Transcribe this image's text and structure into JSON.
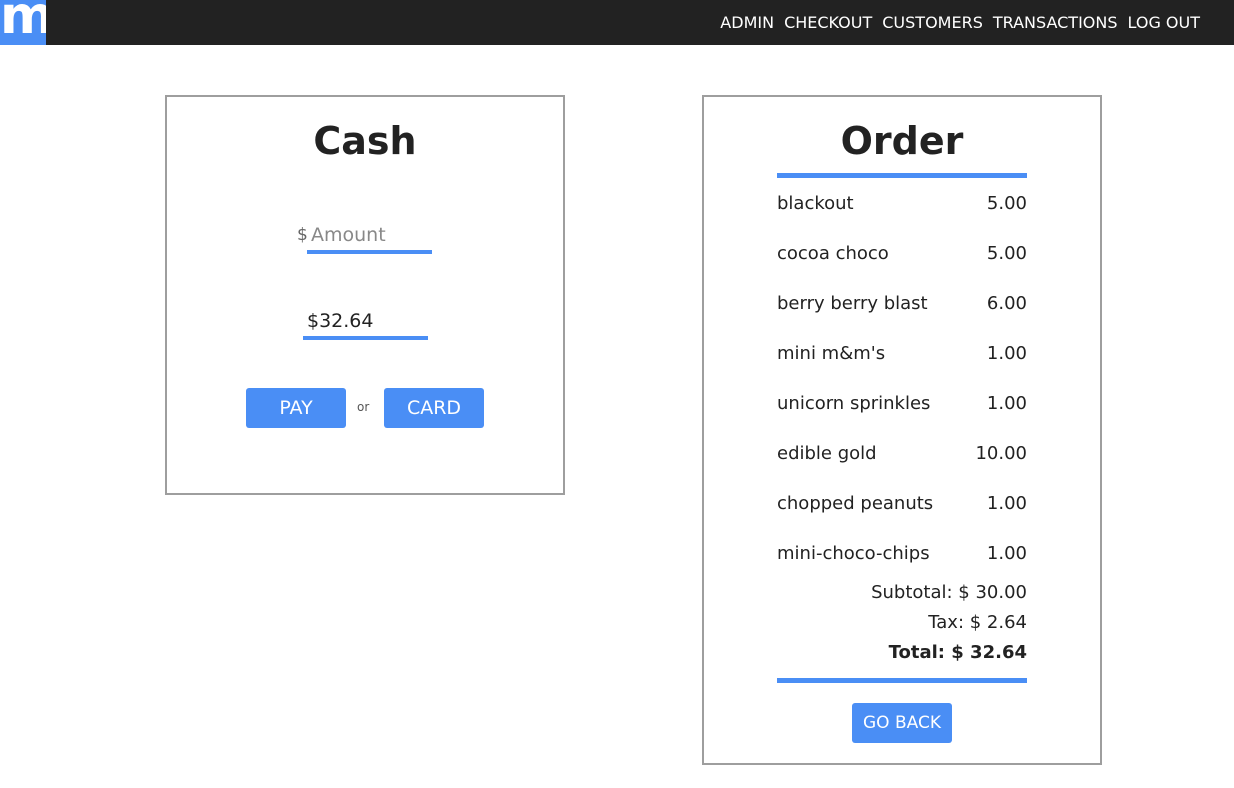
{
  "app": {
    "logo_letter": "m",
    "brand_color": "#4a8ef5"
  },
  "nav": {
    "items": [
      "ADMIN",
      "CHECKOUT",
      "CUSTOMERS",
      "TRANSACTIONS",
      "LOG OUT"
    ]
  },
  "cash": {
    "title": "Cash",
    "currency_symbol": "$",
    "amount_placeholder": "Amount",
    "total_value": "$32.64",
    "pay_label": "PAY",
    "or_label": "or",
    "card_label": "CARD"
  },
  "order": {
    "title": "Order",
    "items": [
      {
        "name": "blackout",
        "price": "5.00"
      },
      {
        "name": "cocoa choco",
        "price": "5.00"
      },
      {
        "name": "berry berry blast",
        "price": "6.00"
      },
      {
        "name": "mini m&m's",
        "price": "1.00"
      },
      {
        "name": "unicorn sprinkles",
        "price": "1.00"
      },
      {
        "name": "edible gold",
        "price": "10.00"
      },
      {
        "name": "chopped peanuts",
        "price": "1.00"
      },
      {
        "name": "mini-choco-chips",
        "price": "1.00"
      }
    ],
    "subtotal": "Subtotal: $ 30.00",
    "tax": "Tax: $ 2.64",
    "total": "Total: $ 32.64",
    "go_back_label": "GO BACK"
  }
}
